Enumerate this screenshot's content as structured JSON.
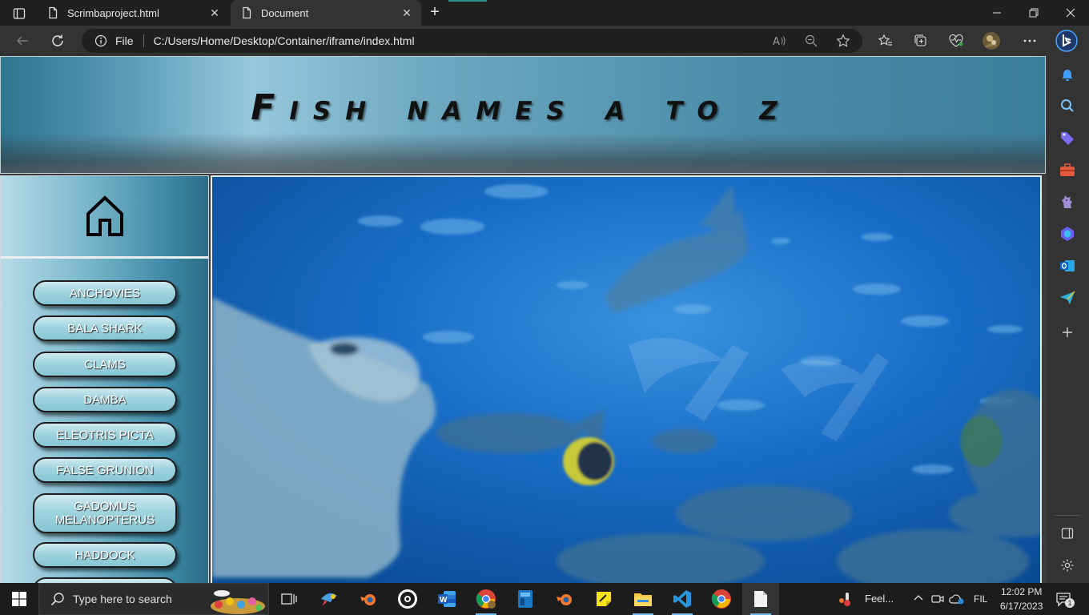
{
  "browser": {
    "tabs": [
      {
        "label": "Scrimbaproject.html",
        "active": false
      },
      {
        "label": "Document",
        "active": true
      }
    ],
    "address": {
      "scheme": "File",
      "url": "C:/Users/Home/Desktop/Container/iframe/index.html"
    },
    "accent_color": "#2b8c8c"
  },
  "page": {
    "title": "Fish names a to z",
    "nav_buttons": [
      "ANCHOVIES",
      "BALA SHARK",
      "CLAMS",
      "DAMBA",
      "ELEOTRIS PICTA",
      "FALSE GRUNION",
      "GADOMUS MELANOPTERUS",
      "HADDOCK"
    ],
    "main_image": "underwater-aquarium-manta-ray-fish",
    "colors": {
      "header": "#5a9bb6",
      "button": "#9fd4df",
      "water": "#1567bf"
    }
  },
  "taskbar": {
    "search_placeholder": "Type here to search",
    "weather_text": "Feel...",
    "language": "FIL",
    "time": "12:02 PM",
    "date": "6/17/2023",
    "notification_count": "1"
  }
}
